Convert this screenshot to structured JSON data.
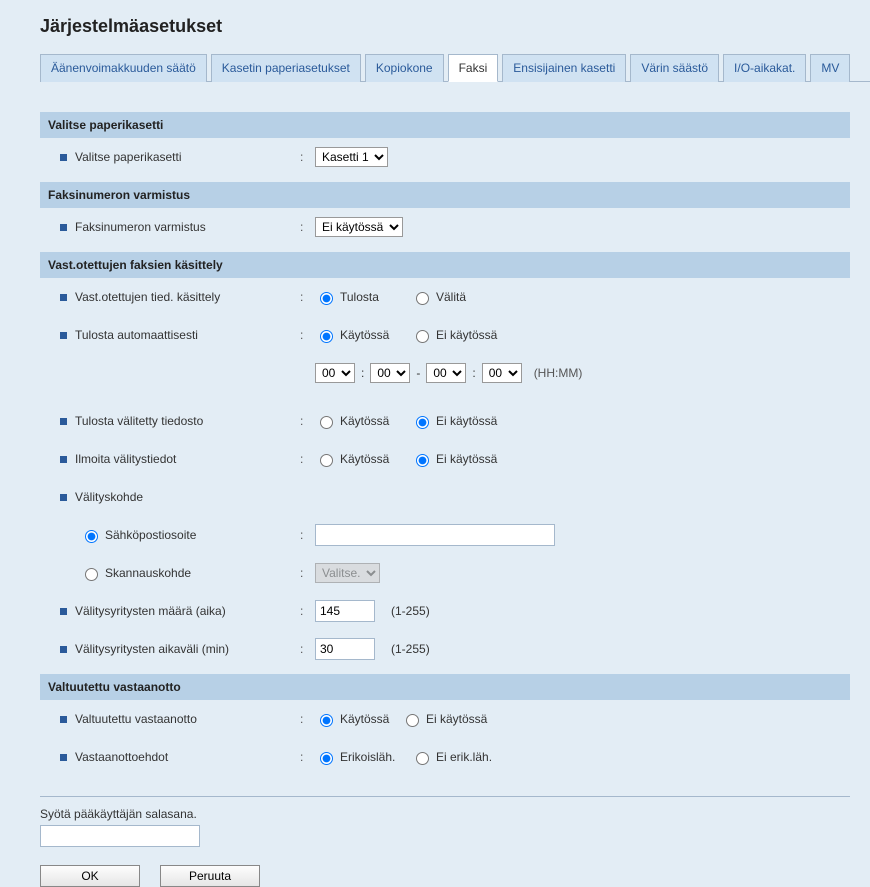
{
  "title": "Järjestelmäasetukset",
  "tabs": {
    "volume": "Äänenvoimakkuuden säätö",
    "cassette": "Kasetin paperiasetukset",
    "copier": "Kopiokone",
    "fax": "Faksi",
    "primary": "Ensisijainen kasetti",
    "toner": "Värin säästö",
    "io": "I/O-aikakat.",
    "mv": "MV"
  },
  "sections": {
    "select_cassette": {
      "header": "Valitse paperikasetti",
      "label": "Valitse paperikasetti",
      "value": "Kasetti 1"
    },
    "fax_confirm": {
      "header": "Faksinumeron varmistus",
      "label": "Faksinumeron varmistus",
      "value": "Ei käytössä"
    },
    "received": {
      "header": "Vast.otettujen faksien käsittely",
      "handling_label": "Vast.otettujen tied. käsittely",
      "handling_opt1": "Tulosta",
      "handling_opt2": "Välitä",
      "auto_print_label": "Tulosta automaattisesti",
      "enabled": "Käytössä",
      "disabled": "Ei käytössä",
      "time_h1": "00",
      "time_m1": "00",
      "time_h2": "00",
      "time_m2": "00",
      "time_suffix": "(HH:MM)",
      "print_fwd_label": "Tulosta välitetty tiedosto",
      "report_fwd_label": "Ilmoita välitystiedot",
      "fwd_dest_label": "Välityskohde",
      "email_label": "Sähköpostiosoite",
      "email_value": "",
      "scan_label": "Skannauskohde",
      "scan_value": "Valitse.",
      "retry_count_label": "Välitysyritysten määrä (aika)",
      "retry_count_value": "145",
      "retry_interval_label": "Välitysyritysten aikaväli (min)",
      "retry_interval_value": "30",
      "range": "(1-255)"
    },
    "auth_rx": {
      "header": "Valtuutettu vastaanotto",
      "label": "Valtuutettu vastaanotto",
      "enabled": "Käytössä",
      "disabled": "Ei käytössä",
      "cond_label": "Vastaanottoehdot",
      "cond_opt1": "Erikoisläh.",
      "cond_opt2": "Ei erik.läh."
    }
  },
  "footer": {
    "password_label": "Syötä pääkäyttäjän salasana.",
    "ok": "OK",
    "cancel": "Peruuta"
  }
}
